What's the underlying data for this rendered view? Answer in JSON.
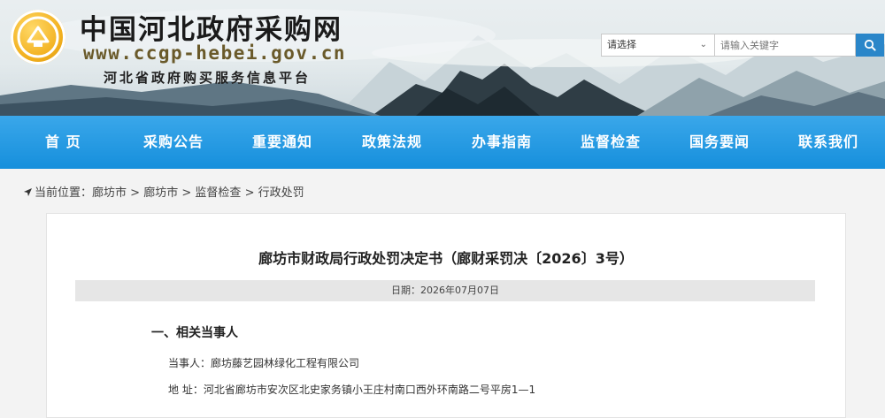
{
  "header": {
    "site_name": "中国河北政府采购网",
    "site_url": "www.ccgp-hebei.gov.cn",
    "slogan": "河北省政府购买服务信息平台",
    "logo_icon": "emblem-logo-icon"
  },
  "search": {
    "select_value": "请选择",
    "input_placeholder": "请输入关键字",
    "button_icon": "search-icon"
  },
  "nav": {
    "items": [
      "首 页",
      "采购公告",
      "重要通知",
      "政策法规",
      "办事指南",
      "监督检查",
      "国务要闻",
      "联系我们"
    ]
  },
  "breadcrumb": {
    "icon": "location-arrow-icon",
    "prefix": "当前位置：",
    "items": [
      "廊坊市",
      "廊坊市",
      "监督检查",
      "行政处罚"
    ],
    "separator": ">"
  },
  "article": {
    "title": "廊坊市财政局行政处罚决定书（廊财采罚决〔2026〕3号）",
    "date": "日期：2026年07月07日",
    "section_heading": "一、相关当事人",
    "party_line": "当事人：廊坊藤艺园林绿化工程有限公司",
    "address_line": "地 址：河北省廊坊市安次区北史家务镇小王庄村南口西外环南路二号平房1—1"
  },
  "colors": {
    "nav_blue": "#1f95e0",
    "search_button": "#2a86c9",
    "logo_gold": "#f2b01e"
  }
}
